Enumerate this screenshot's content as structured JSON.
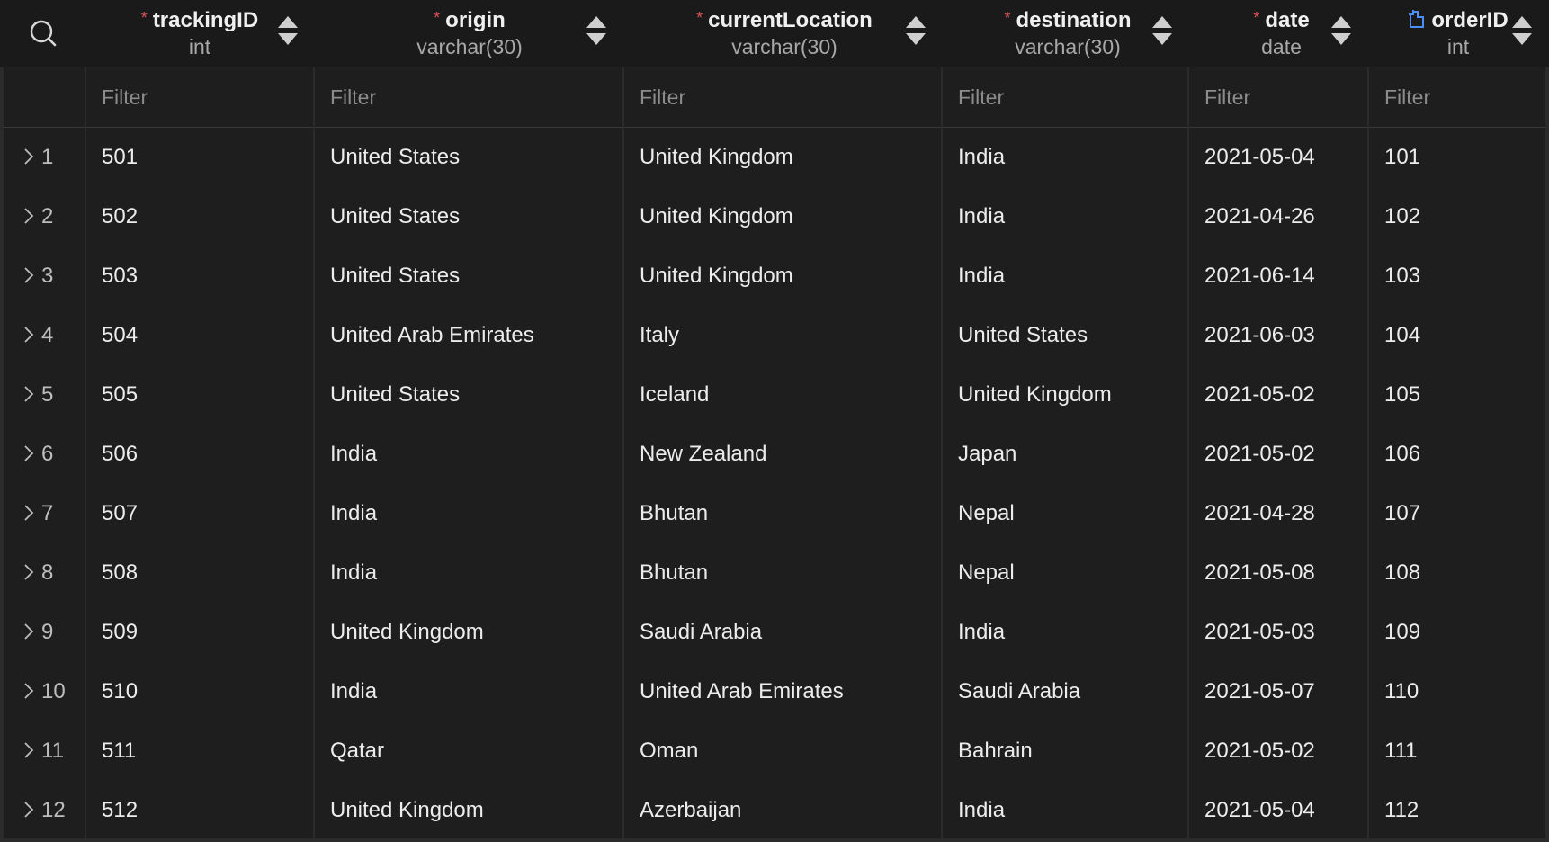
{
  "columns": [
    {
      "name": "trackingID",
      "type": "int",
      "required": true,
      "icon": "required-asterisk"
    },
    {
      "name": "origin",
      "type": "varchar(30)",
      "required": true,
      "icon": "required-asterisk"
    },
    {
      "name": "currentLocation",
      "type": "varchar(30)",
      "required": true,
      "icon": "required-asterisk"
    },
    {
      "name": "destination",
      "type": "varchar(30)",
      "required": true,
      "icon": "required-asterisk"
    },
    {
      "name": "date",
      "type": "date",
      "required": true,
      "icon": "required-asterisk"
    },
    {
      "name": "orderID",
      "type": "int",
      "required": false,
      "icon": "foreign-key-icon"
    }
  ],
  "filter_placeholder": "Filter",
  "rows": [
    {
      "n": "1",
      "cells": [
        "501",
        "United States",
        "United Kingdom",
        "India",
        "2021-05-04",
        "101"
      ]
    },
    {
      "n": "2",
      "cells": [
        "502",
        "United States",
        "United Kingdom",
        "India",
        "2021-04-26",
        "102"
      ]
    },
    {
      "n": "3",
      "cells": [
        "503",
        "United States",
        "United Kingdom",
        "India",
        "2021-06-14",
        "103"
      ]
    },
    {
      "n": "4",
      "cells": [
        "504",
        "United Arab Emirates",
        "Italy",
        "United States",
        "2021-06-03",
        "104"
      ]
    },
    {
      "n": "5",
      "cells": [
        "505",
        "United States",
        "Iceland",
        "United Kingdom",
        "2021-05-02",
        "105"
      ]
    },
    {
      "n": "6",
      "cells": [
        "506",
        "India",
        "New Zealand",
        "Japan",
        "2021-05-02",
        "106"
      ]
    },
    {
      "n": "7",
      "cells": [
        "507",
        "India",
        "Bhutan",
        "Nepal",
        "2021-04-28",
        "107"
      ]
    },
    {
      "n": "8",
      "cells": [
        "508",
        "India",
        "Bhutan",
        "Nepal",
        "2021-05-08",
        "108"
      ]
    },
    {
      "n": "9",
      "cells": [
        "509",
        "United Kingdom",
        "Saudi Arabia",
        "India",
        "2021-05-03",
        "109"
      ]
    },
    {
      "n": "10",
      "cells": [
        "510",
        "India",
        "United Arab Emirates",
        "Saudi Arabia",
        "2021-05-07",
        "110"
      ]
    },
    {
      "n": "11",
      "cells": [
        "511",
        "Qatar",
        "Oman",
        "Bahrain",
        "2021-05-02",
        "111"
      ]
    },
    {
      "n": "12",
      "cells": [
        "512",
        "United Kingdom",
        "Azerbaijan",
        "India",
        "2021-05-04",
        "112"
      ]
    }
  ],
  "colors": {
    "background": "#1e1e1e",
    "header": "#1a1a1a",
    "required": "#e05252",
    "key_icon": "#4a8ff7"
  }
}
